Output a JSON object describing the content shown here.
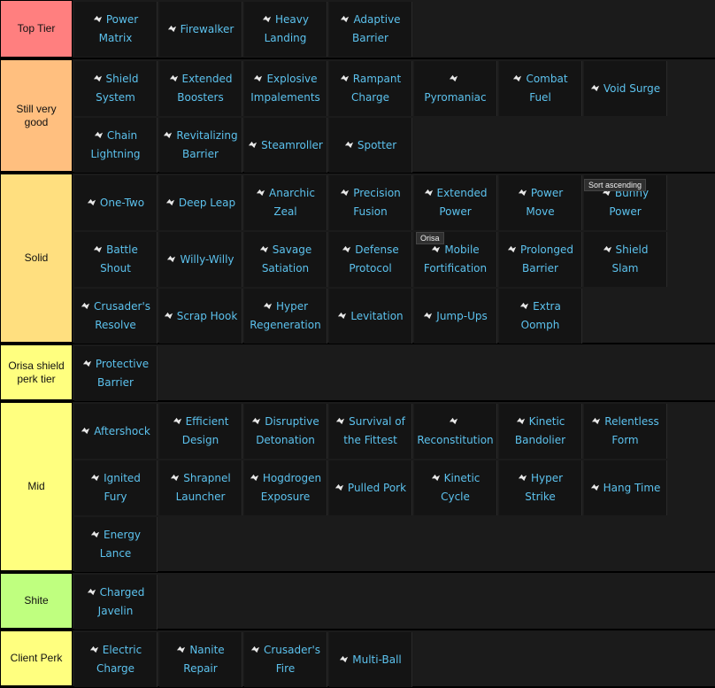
{
  "tiers": [
    {
      "label": "Top Tier",
      "color": "#ff7f7f",
      "items": [
        {
          "name": "Power Matrix",
          "icon": "power-matrix-icon"
        },
        {
          "name": "Firewalker",
          "icon": "firewalker-icon"
        },
        {
          "name": "Heavy Landing",
          "icon": "heavy-landing-icon"
        },
        {
          "name": "Adaptive Barrier",
          "icon": "adaptive-barrier-icon"
        }
      ]
    },
    {
      "label": "Still very good",
      "color": "#ffbf7f",
      "items": [
        {
          "name": "Shield System",
          "icon": "shield-system-icon"
        },
        {
          "name": "Extended Boosters",
          "icon": "boosters-icon"
        },
        {
          "name": "Explosive Impalements",
          "icon": "explosion-icon"
        },
        {
          "name": "Rampant Charge",
          "icon": "rampant-charge-icon"
        },
        {
          "name": "Pyromaniac",
          "icon": "pyromaniac-icon"
        },
        {
          "name": "Combat Fuel",
          "icon": "combat-fuel-icon"
        },
        {
          "name": "Void Surge",
          "icon": "void-surge-icon"
        },
        {
          "name": "Chain Lightning",
          "icon": "chain-lightning-icon"
        },
        {
          "name": "Revitalizing Barrier",
          "icon": "revitalizing-barrier-icon"
        },
        {
          "name": "Steamroller",
          "icon": "steamroller-icon"
        },
        {
          "name": "Spotter",
          "icon": "spotter-icon"
        }
      ]
    },
    {
      "label": "Solid",
      "color": "#ffdf7f",
      "items": [
        {
          "name": "One-Two",
          "icon": "one-two-icon"
        },
        {
          "name": "Deep Leap",
          "icon": "deep-leap-icon"
        },
        {
          "name": "Anarchic Zeal",
          "icon": "anarchic-zeal-icon"
        },
        {
          "name": "Precision Fusion",
          "icon": "precision-fusion-icon"
        },
        {
          "name": "Extended Power",
          "icon": "extended-power-icon"
        },
        {
          "name": "Power Move",
          "icon": "power-move-icon"
        },
        {
          "name": "Bunny Power",
          "icon": "bunny-power-icon"
        },
        {
          "name": "Battle Shout",
          "icon": "battle-shout-icon"
        },
        {
          "name": "Willy-Willy",
          "icon": "willy-willy-icon"
        },
        {
          "name": "Savage Satiation",
          "icon": "savage-satiation-icon"
        },
        {
          "name": "Defense Protocol",
          "icon": "defense-protocol-icon"
        },
        {
          "name": "Mobile Fortification",
          "icon": "mobile-fortification-icon"
        },
        {
          "name": "Prolonged Barrier",
          "icon": "prolonged-barrier-icon"
        },
        {
          "name": "Shield Slam",
          "icon": "shield-slam-icon"
        },
        {
          "name": "Crusader's Resolve",
          "icon": "crusaders-resolve-icon"
        },
        {
          "name": "Scrap Hook",
          "icon": "scrap-hook-icon"
        },
        {
          "name": "Hyper Regeneration",
          "icon": "hyper-regeneration-icon"
        },
        {
          "name": "Levitation",
          "icon": "levitation-icon"
        },
        {
          "name": "Jump-Ups",
          "icon": "jump-ups-icon"
        },
        {
          "name": "Extra Oomph",
          "icon": "extra-oomph-icon"
        }
      ]
    },
    {
      "label": "Orisa shield perk tier",
      "color": "#ffff7f",
      "items": [
        {
          "name": "Protective Barrier",
          "icon": "protective-barrier-icon"
        }
      ]
    },
    {
      "label": "Mid",
      "color": "#ffff7f",
      "items": [
        {
          "name": "Aftershock",
          "icon": "aftershock-icon"
        },
        {
          "name": "Efficient Design",
          "icon": "efficient-design-icon"
        },
        {
          "name": "Disruptive Detonation",
          "icon": "disruptive-detonation-icon"
        },
        {
          "name": "Survival of the Fittest",
          "icon": "survival-icon"
        },
        {
          "name": "Reconstitution",
          "icon": "reconstitution-icon"
        },
        {
          "name": "Kinetic Bandolier",
          "icon": "kinetic-bandolier-icon"
        },
        {
          "name": "Relentless Form",
          "icon": "relentless-form-icon"
        },
        {
          "name": "Ignited Fury",
          "icon": "ignited-fury-icon"
        },
        {
          "name": "Shrapnel Launcher",
          "icon": "shrapnel-launcher-icon"
        },
        {
          "name": "Hogdrogen Exposure",
          "icon": "hogdrogen-icon"
        },
        {
          "name": "Pulled Pork",
          "icon": "pulled-pork-icon"
        },
        {
          "name": "Kinetic Cycle",
          "icon": "kinetic-cycle-icon"
        },
        {
          "name": "Hyper Strike",
          "icon": "hyper-strike-icon"
        },
        {
          "name": "Hang Time",
          "icon": "hang-time-icon"
        },
        {
          "name": "Energy Lance",
          "icon": "energy-lance-icon"
        }
      ]
    },
    {
      "label": "Shite",
      "color": "#bfff7f",
      "items": [
        {
          "name": "Charged Javelin",
          "icon": "charged-javelin-icon"
        }
      ]
    },
    {
      "label": "Client Perk",
      "color": "#ffff7f",
      "items": [
        {
          "name": "Electric Charge",
          "icon": "electric-charge-icon"
        },
        {
          "name": "Nanite Repair",
          "icon": "nanite-repair-icon"
        },
        {
          "name": "Crusader's Fire",
          "icon": "crusaders-fire-icon"
        },
        {
          "name": "Multi-Ball",
          "icon": "multi-ball-icon"
        }
      ]
    }
  ],
  "tooltips": {
    "sort": "Sort ascending",
    "hover": "Orisa"
  }
}
